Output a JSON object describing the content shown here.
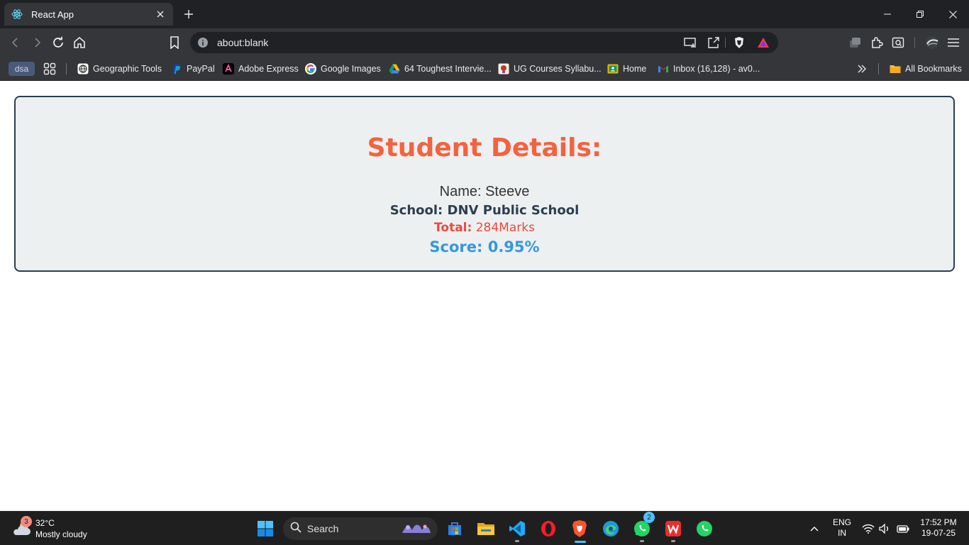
{
  "browser": {
    "tab_title": "React App",
    "url": "about:blank",
    "bookmarks": {
      "chip": "dsa",
      "items": [
        {
          "label": "Geographic Tools"
        },
        {
          "label": "PayPal"
        },
        {
          "label": "Adobe Express"
        },
        {
          "label": "Google Images"
        },
        {
          "label": "64 Toughest Intervie..."
        },
        {
          "label": "UG Courses Syllabu..."
        },
        {
          "label": "Home"
        },
        {
          "label": "Inbox (16,128) - av0..."
        }
      ],
      "all_bookmarks": "All Bookmarks"
    }
  },
  "card": {
    "heading": "Student Details:",
    "name_label": "Name: ",
    "name_value": "Steeve",
    "school_label": "School:",
    "school_value": "DNV Public School",
    "total_label": "Total:",
    "total_value": "284Marks",
    "score_label": "Score:",
    "score_value": "0.95%"
  },
  "taskbar": {
    "weather_badge": "3",
    "temperature": "32°C",
    "condition": "Mostly cloudy",
    "search_label": "Search",
    "whatsapp_badge": "2",
    "language": "ENG",
    "region": "IN",
    "time": "17:52 PM",
    "date": "19-07-25"
  },
  "colors": {
    "heading": "#f5623e",
    "school": "#2c3e50",
    "total": "#e74c3c",
    "score": "#3498db",
    "card_bg": "#ecf0f1"
  }
}
